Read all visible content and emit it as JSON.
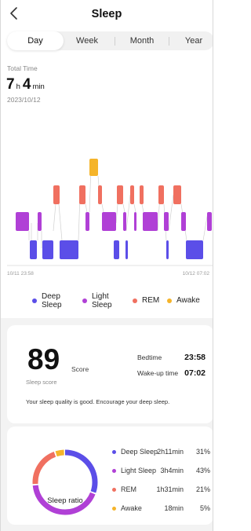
{
  "header": {
    "title": "Sleep",
    "back_icon": "chevron-left-icon"
  },
  "tabs": [
    {
      "label": "Day",
      "active": true
    },
    {
      "label": "Week",
      "active": false
    },
    {
      "label": "Month",
      "active": false
    },
    {
      "label": "Year",
      "active": false
    }
  ],
  "summary": {
    "total_label": "Total Time",
    "hours": "7",
    "hours_unit": "h",
    "minutes": "4",
    "minutes_unit": "min",
    "date": "2023/10/12"
  },
  "timeline": {
    "start_label": "10/11 23:58",
    "end_label": "10/12 07:02"
  },
  "legend": [
    {
      "label": "Deep Sleep",
      "color": "#5b4ee8"
    },
    {
      "label": "Light Sleep",
      "color": "#b040d6"
    },
    {
      "label": "REM",
      "color": "#f07060"
    },
    {
      "label": "Awake",
      "color": "#f5b42a"
    }
  ],
  "score_card": {
    "score": "89",
    "score_label": "Score",
    "score_sub": "Sleep score",
    "bedtime_label": "Bedtime",
    "bedtime": "23:58",
    "wakeup_label": "Wake-up time",
    "wakeup": "07:02",
    "message": "Your sleep quality is good. Encourage your deep sleep."
  },
  "ratio_card": {
    "title": "Sleep ratio",
    "rows": [
      {
        "name": "Deep Sleep",
        "duration": "2h11min",
        "percent": "31%",
        "value": 31,
        "color": "#5b4ee8"
      },
      {
        "name": "Light Sleep",
        "duration": "3h4min",
        "percent": "43%",
        "value": 43,
        "color": "#b040d6"
      },
      {
        "name": "REM",
        "duration": "1h31min",
        "percent": "21%",
        "value": 21,
        "color": "#f07060"
      },
      {
        "name": "Awake",
        "duration": "18min",
        "percent": "5%",
        "value": 5,
        "color": "#f5b42a"
      }
    ]
  }
}
